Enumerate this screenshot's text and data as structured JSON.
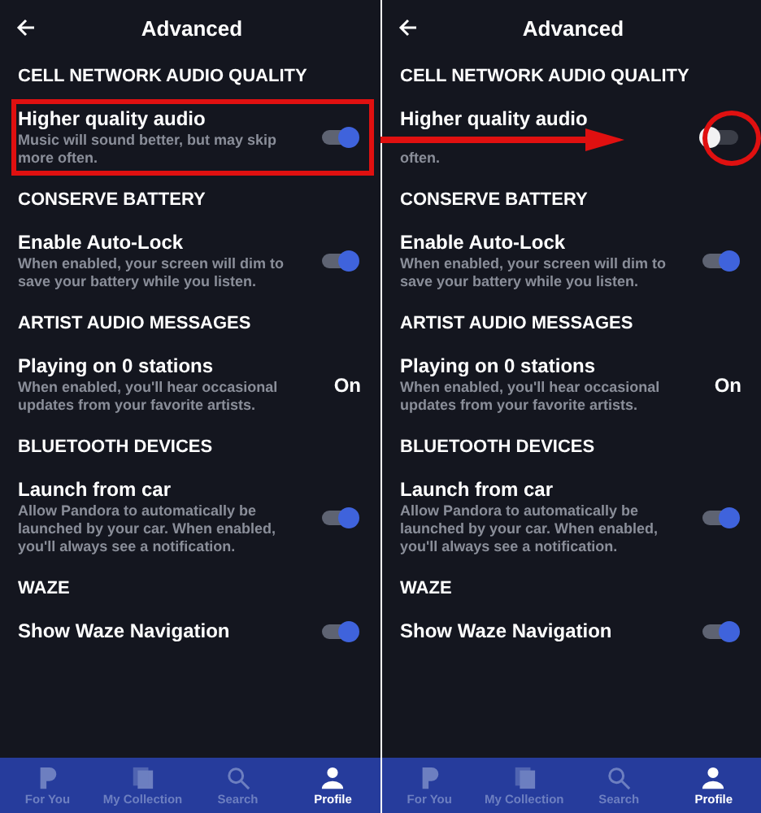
{
  "panels": [
    {
      "title": "Advanced",
      "sections": [
        {
          "heading": "CELL NETWORK AUDIO QUALITY",
          "rows": [
            {
              "title": "Higher quality audio",
              "description": "Music will sound better, but may skip more often.",
              "kind": "toggle",
              "on": true,
              "boxed": true
            }
          ]
        },
        {
          "heading": "CONSERVE BATTERY",
          "rows": [
            {
              "title": "Enable Auto-Lock",
              "description": "When enabled, your screen will dim to save your battery while you listen.",
              "kind": "toggle",
              "on": true
            }
          ]
        },
        {
          "heading": "ARTIST AUDIO MESSAGES",
          "rows": [
            {
              "title": "Playing on 0 stations",
              "description": "When enabled, you'll hear occasional updates from your favorite artists.",
              "kind": "value",
              "value": "On"
            }
          ]
        },
        {
          "heading": "BLUETOOTH DEVICES",
          "rows": [
            {
              "title": "Launch from car",
              "description": "Allow Pandora to automatically be launched by your car. When enabled, you'll always see a notification.",
              "kind": "toggle",
              "on": true
            }
          ]
        },
        {
          "heading": "WAZE",
          "rows": [
            {
              "title": "Show Waze Navigation",
              "kind": "toggle",
              "on": true
            }
          ]
        }
      ],
      "nav": [
        {
          "label": "For You",
          "selected": false
        },
        {
          "label": "My Collection",
          "selected": false
        },
        {
          "label": "Search",
          "selected": false
        },
        {
          "label": "Profile",
          "selected": true
        }
      ]
    },
    {
      "title": "Advanced",
      "sections": [
        {
          "heading": "CELL NETWORK AUDIO QUALITY",
          "rows": [
            {
              "title": "Higher quality audio",
              "description": "often.",
              "kind": "toggle",
              "on": false,
              "circled": true,
              "arrow": true
            }
          ]
        },
        {
          "heading": "CONSERVE BATTERY",
          "rows": [
            {
              "title": "Enable Auto-Lock",
              "description": "When enabled, your screen will dim to save your battery while you listen.",
              "kind": "toggle",
              "on": true
            }
          ]
        },
        {
          "heading": "ARTIST AUDIO MESSAGES",
          "rows": [
            {
              "title": "Playing on 0 stations",
              "description": "When enabled, you'll hear occasional updates from your favorite artists.",
              "kind": "value",
              "value": "On"
            }
          ]
        },
        {
          "heading": "BLUETOOTH DEVICES",
          "rows": [
            {
              "title": "Launch from car",
              "description": "Allow Pandora to automatically be launched by your car. When enabled, you'll always see a notification.",
              "kind": "toggle",
              "on": true
            }
          ]
        },
        {
          "heading": "WAZE",
          "rows": [
            {
              "title": "Show Waze Navigation",
              "kind": "toggle",
              "on": true
            }
          ]
        }
      ],
      "nav": [
        {
          "label": "For You",
          "selected": false
        },
        {
          "label": "My Collection",
          "selected": false
        },
        {
          "label": "Search",
          "selected": false
        },
        {
          "label": "Profile",
          "selected": true
        }
      ]
    }
  ]
}
